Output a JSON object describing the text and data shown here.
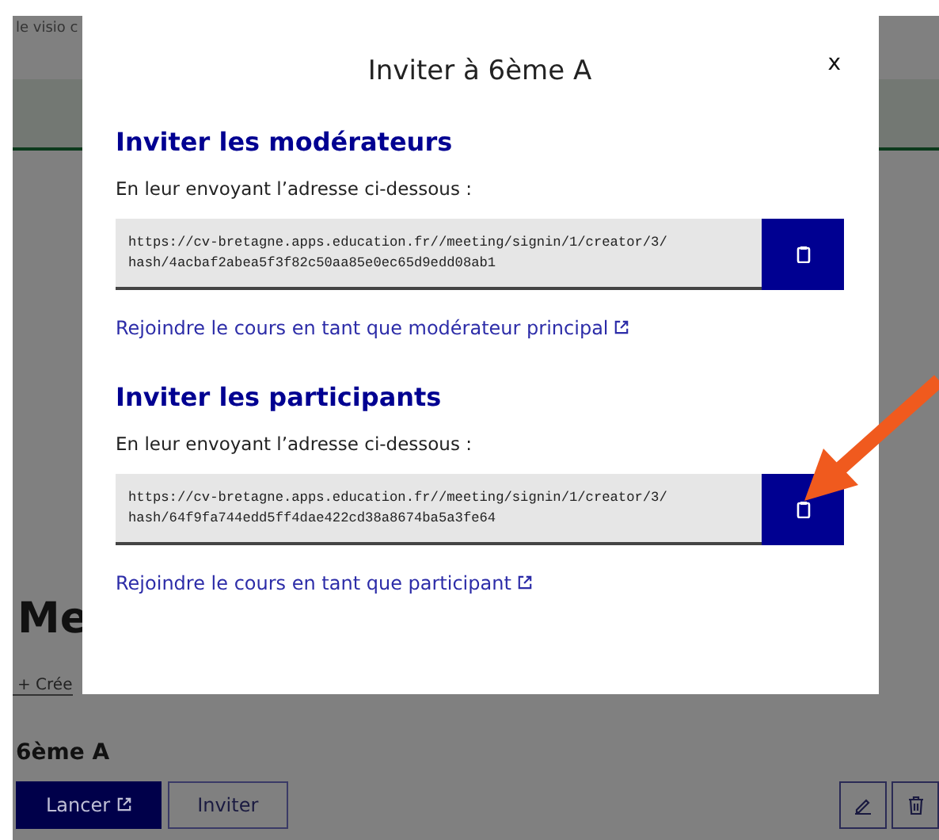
{
  "background_page": {
    "top_text": "le visio c",
    "heading": "Me",
    "create_link": "+ Crée",
    "room": {
      "name": "6ème A",
      "buttons": [
        {
          "label": "Lancer",
          "kind": "primary"
        },
        {
          "label": "Inviter",
          "kind": "secondary"
        }
      ]
    }
  },
  "modal": {
    "title": "Inviter à 6ème A",
    "close": "x",
    "sections": [
      {
        "heading": "Inviter les modérateurs",
        "instruction": "En leur envoyant l’adresse ci-dessous :",
        "url": "https://cv-bretagne.apps.education.fr//meeting/signin/1/creator/3/hash/4acbaf2abea5f3f82c50aa85e0ec65d9edd08ab1",
        "link": "Rejoindre le cours en tant que modérateur principal"
      },
      {
        "heading": "Inviter les participants",
        "instruction": "En leur envoyant l’adresse ci-dessous :",
        "url": "https://cv-bretagne.apps.education.fr//meeting/signin/1/creator/3/hash/64f9fa744edd5ff4dae422cd38a8674ba5a3fe64",
        "link": "Rejoindre le cours en tant que participant"
      }
    ]
  }
}
